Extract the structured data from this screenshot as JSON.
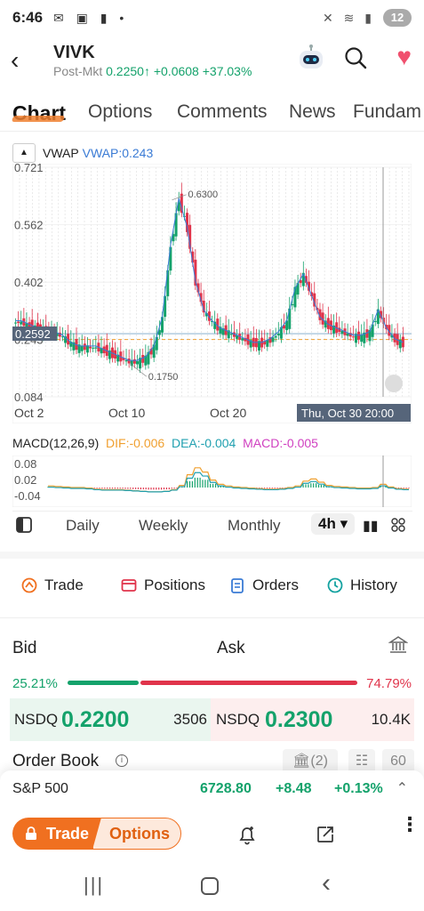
{
  "status": {
    "time": "6:46",
    "battery": "12"
  },
  "header": {
    "symbol": "VIVK",
    "post_label": "Post-Mkt",
    "post_price": "0.2250",
    "post_arrow": "↑",
    "post_change": "+0.0608",
    "post_pct": "+37.03%"
  },
  "tabs": [
    "Chart",
    "Options",
    "Comments",
    "News",
    "Fundam"
  ],
  "chart": {
    "indicator": "VWAP",
    "vwap_value": "VWAP:0.243",
    "y_ticks": [
      "0.721",
      "0.562",
      "0.402",
      "0.243",
      "0.084"
    ],
    "current_price_label": "0.2592",
    "high_label": "0.6300",
    "low_label": "0.1750",
    "x_ticks": [
      "Oct 2",
      "Oct 10",
      "Oct 20"
    ],
    "crosshair_time": "Thu, Oct 30 20:00"
  },
  "chart_data": {
    "type": "candlestick",
    "y_range": [
      0.084,
      0.721
    ],
    "series": [
      {
        "name": "VIVK 4h",
        "values": [
          0.29,
          0.28,
          0.27,
          0.26,
          0.26,
          0.25,
          0.23,
          0.22,
          0.22,
          0.22,
          0.21,
          0.2,
          0.19,
          0.18,
          0.18,
          0.19,
          0.22,
          0.3,
          0.5,
          0.63,
          0.55,
          0.4,
          0.32,
          0.29,
          0.27,
          0.26,
          0.25,
          0.24,
          0.23,
          0.23,
          0.24,
          0.26,
          0.29,
          0.38,
          0.42,
          0.36,
          0.3,
          0.28,
          0.27,
          0.26,
          0.25,
          0.25,
          0.26,
          0.32,
          0.27,
          0.24,
          0.23
        ]
      }
    ],
    "annotations": {
      "high": 0.63,
      "low": 0.175,
      "vwap": 0.243,
      "last": 0.2592
    }
  },
  "macd": {
    "title": "MACD(12,26,9)",
    "dif": "DIF:-0.006",
    "dea": "DEA:-0.004",
    "macd": "MACD:-0.005",
    "ticks": [
      "0.08",
      "0.02",
      "-0.04"
    ]
  },
  "periods": {
    "daily": "Daily",
    "weekly": "Weekly",
    "monthly": "Monthly",
    "selected": "4h"
  },
  "actions": {
    "trade": "Trade",
    "positions": "Positions",
    "orders": "Orders",
    "history": "History"
  },
  "quote": {
    "bid_label": "Bid",
    "ask_label": "Ask",
    "bid_pct": "25.21%",
    "ask_pct": "74.79%",
    "bid_pct_value": 0.2521,
    "bid_exchange": "NSDQ",
    "bid_price": "0.2200",
    "bid_size": "3506",
    "ask_exchange": "NSDQ",
    "ask_price": "0.2300",
    "ask_size": "10.4K"
  },
  "order_book": {
    "title": "Order Book",
    "depth_count": "(2)",
    "levels": "60"
  },
  "index": {
    "name": "S&P 500",
    "value": "6728.80",
    "change": "+8.48",
    "pct": "+0.13%"
  },
  "bottom": {
    "trade": "Trade",
    "options": "Options"
  },
  "colors": {
    "accent": "#f07020",
    "up": "#14a26b",
    "down": "#e0344b",
    "vwap": "#3a7bd5"
  }
}
